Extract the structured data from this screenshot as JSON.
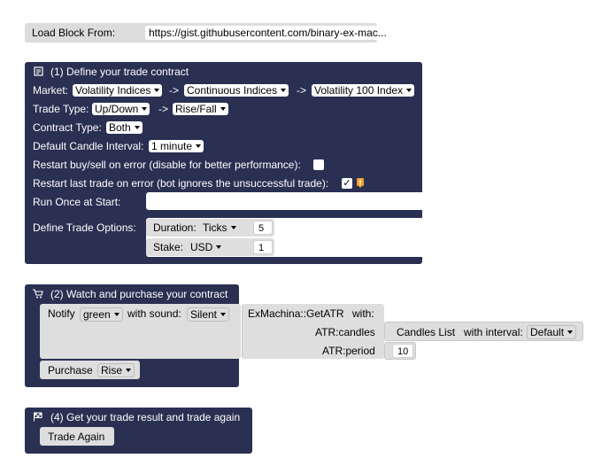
{
  "load_block": {
    "label": "Load Block From:",
    "url": "https://gist.githubusercontent.com/binary-ex-mac..."
  },
  "block1": {
    "icon": "document-icon",
    "title": "(1) Define your trade contract",
    "market_label": "Market:",
    "market": [
      "Volatility Indices",
      "Continuous Indices",
      "Volatility 100 Index"
    ],
    "arrow": "->",
    "trade_type_label": "Trade Type:",
    "trade_type": [
      "Up/Down",
      "Rise/Fall"
    ],
    "contract_type_label": "Contract Type:",
    "contract_type": "Both",
    "candle_interval_label": "Default Candle Interval:",
    "candle_interval": "1 minute",
    "restart_error_label": "Restart buy/sell on error  (disable for better performance):",
    "restart_error_checked": false,
    "restart_last_label": "Restart last trade on error  (bot ignores the unsuccessful trade):",
    "restart_last_checked": true,
    "run_once_label": "Run Once at Start:",
    "trade_options_label": "Define Trade Options:",
    "duration_label": "Duration:",
    "duration_unit": "Ticks",
    "duration_value": "5",
    "stake_label": "Stake:",
    "stake_currency": "USD",
    "stake_value": "1"
  },
  "block2": {
    "icon": "cart-icon",
    "title": "(2) Watch and purchase your contract",
    "notify_label": "Notify",
    "notify_color": "green",
    "with_sound_label": "with sound:",
    "sound": "Silent",
    "exmachina_label": "ExMachina::GetATR",
    "with_label": "with:",
    "atr_candles_label": "ATR:candles",
    "candles_list_label": "Candles List",
    "with_interval_label": "with interval:",
    "interval": "Default",
    "atr_period_label": "ATR:period",
    "atr_period_value": "10",
    "purchase_label": "Purchase",
    "purchase_type": "Rise"
  },
  "block4": {
    "icon": "flag-icon",
    "title": "(4) Get your trade result and trade again",
    "trade_again_label": "Trade Again"
  },
  "colors": {
    "block_dark": "#2a3052",
    "block_light": "#dedede",
    "warning": "#f0a030"
  }
}
